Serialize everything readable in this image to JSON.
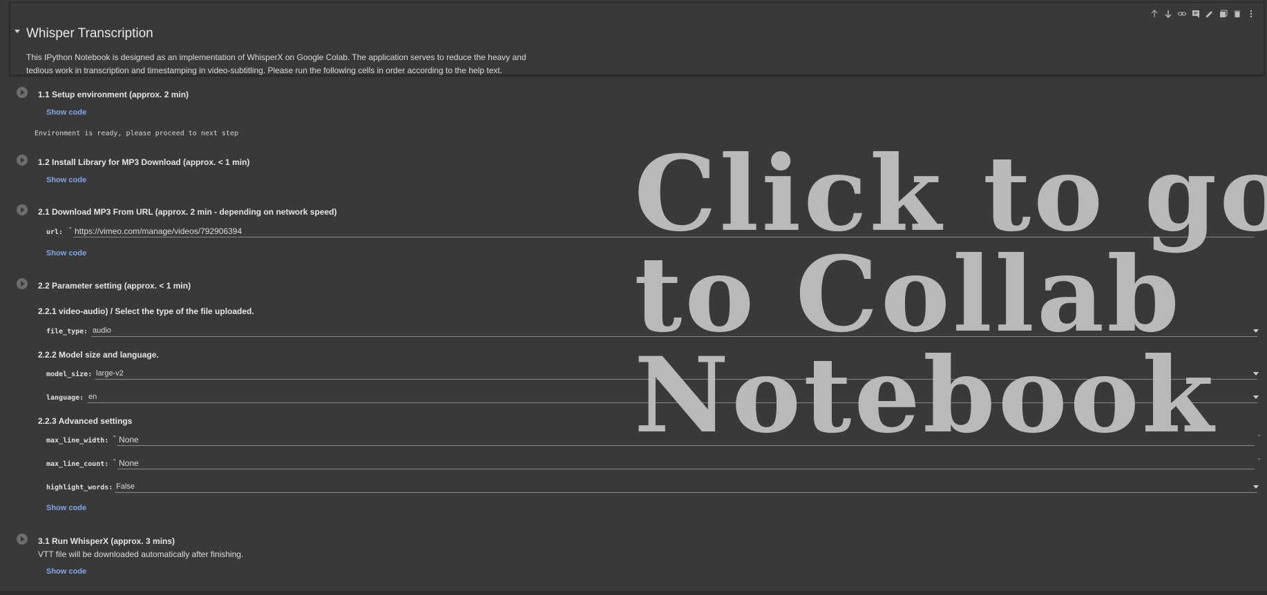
{
  "notebook": {
    "title": "Whisper Transcription",
    "description": "This IPython Notebook is designed as an implementation of WhisperX on Google Colab. The application serves to reduce the heavy and tedious work in transcription and timestamping in video-subtitling. Please run the following cells in order according to the help text."
  },
  "toolbar": {
    "icons": [
      "arrow-up-icon",
      "arrow-down-icon",
      "link-icon",
      "comment-icon",
      "edit-icon",
      "copy-icon",
      "delete-icon",
      "more-icon"
    ]
  },
  "sections": {
    "s11": {
      "title": "1.1 Setup environment (approx. 2 min)",
      "show_code": "Show code",
      "output": "Environment is ready, please proceed to next step"
    },
    "s12": {
      "title": "1.2 Install Library for MP3 Download (approx. < 1 min)",
      "show_code": "Show code"
    },
    "s21": {
      "title": "2.1 Download MP3 From URL (approx. 2 min - depending on network speed)",
      "url_label": "url:",
      "url_value": "https://vimeo.com/manage/videos/792906394",
      "show_code": "Show code"
    },
    "s22": {
      "title": "2.2 Parameter setting (approx. < 1 min)",
      "sub1": "2.2.1 video-audio)  / Select the type of the file uploaded.",
      "file_type_label": "file_type:",
      "file_type_value": "audio",
      "sub2": "2.2.2 Model size and language.",
      "model_size_label": "model_size:",
      "model_size_value": "large-v2",
      "language_label": "language:",
      "language_value": "en",
      "sub3": "2.2.3 Advanced settings",
      "max_line_width_label": "max_line_width:",
      "max_line_width_value": "None",
      "max_line_count_label": "max_line_count:",
      "max_line_count_value": "None",
      "highlight_words_label": "highlight_words:",
      "highlight_words_value": "False",
      "show_code": "Show code"
    },
    "s31": {
      "title": "3.1 Run WhisperX (approx. 3 mins)",
      "note": "VTT file will be downloaded automatically after finishing.",
      "show_code": "Show code"
    }
  },
  "overlay": {
    "line1": "Click to go",
    "line2": "to Collab",
    "line3": "Notebook"
  }
}
